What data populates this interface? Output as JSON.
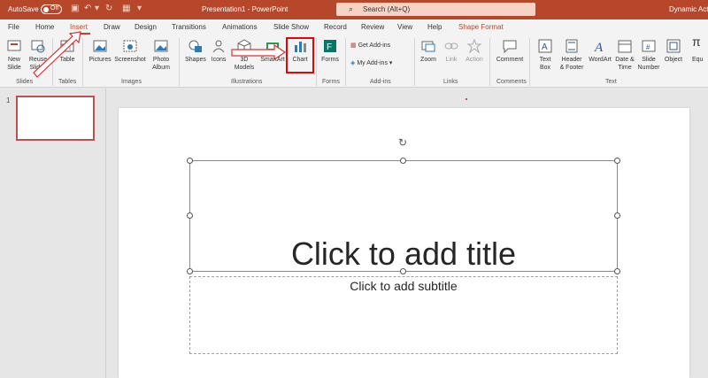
{
  "titlebar": {
    "autosave_label": "AutoSave",
    "autosave_state": "Off",
    "document_title": "Presentation1 - PowerPoint",
    "search_placeholder": "Search (Alt+Q)",
    "account": "Dynamic Acti"
  },
  "tabs": [
    "File",
    "Home",
    "Insert",
    "Draw",
    "Design",
    "Transitions",
    "Animations",
    "Slide Show",
    "Record",
    "Review",
    "View",
    "Help",
    "Shape Format"
  ],
  "ribbon": {
    "slides": {
      "new_slide": "New\nSlide",
      "reuse_slides": "Reuse\nSlides",
      "label": "Slides"
    },
    "tables": {
      "table": "Table",
      "label": "Tables"
    },
    "images": {
      "pictures": "Pictures",
      "screenshot": "Screenshot",
      "photo_album": "Photo\nAlbum",
      "label": "Images"
    },
    "illustrations": {
      "shapes": "Shapes",
      "icons": "Icons",
      "models_3d": "3D\nModels",
      "smartart": "SmartArt",
      "chart": "Chart",
      "label": "Illustrations"
    },
    "forms": {
      "forms": "Forms",
      "label": "Forms"
    },
    "addins": {
      "get_addins": "Get Add-ins",
      "my_addins": "My Add-ins",
      "label": "Add-ins"
    },
    "links": {
      "zoom": "Zoom",
      "link": "Link",
      "action": "Action",
      "label": "Links"
    },
    "comments": {
      "comment": "Comment",
      "label": "Comments"
    },
    "text": {
      "text_box": "Text\nBox",
      "header_footer": "Header\n& Footer",
      "wordart": "WordArt",
      "date_time": "Date &\nTime",
      "slide_number": "Slide\nNumber",
      "object": "Object",
      "equation": "Equ",
      "label": "Text"
    }
  },
  "thumbnails": {
    "slide_number": "1"
  },
  "slide": {
    "title_placeholder": "Click to add title",
    "subtitle_placeholder": "Click to add subtitle"
  },
  "colors": {
    "accent": "#b7472a",
    "highlight": "#e00000"
  }
}
